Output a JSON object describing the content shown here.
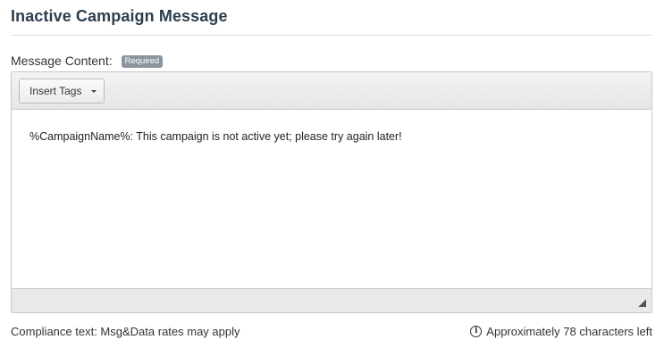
{
  "section": {
    "title": "Inactive Campaign Message"
  },
  "message_field": {
    "label": "Message Content:",
    "required_badge": "Required"
  },
  "editor": {
    "toolbar": {
      "insert_tags_label": "Insert Tags"
    },
    "content": "%CampaignName%: This campaign is not active yet; please try again later!"
  },
  "footer": {
    "compliance_text": "Compliance text: Msg&Data rates may apply",
    "char_count_text": "Approximately 78 characters left",
    "info_icon_glyph": "i"
  },
  "icons": {
    "dropdown": "chevron-down-icon",
    "resize": "resize-grip-icon",
    "info": "info-circle-icon"
  },
  "colors": {
    "title": "#2d3e4e",
    "badge_bg": "#8a959f",
    "toolbar_bg": "#e6e6e6"
  }
}
